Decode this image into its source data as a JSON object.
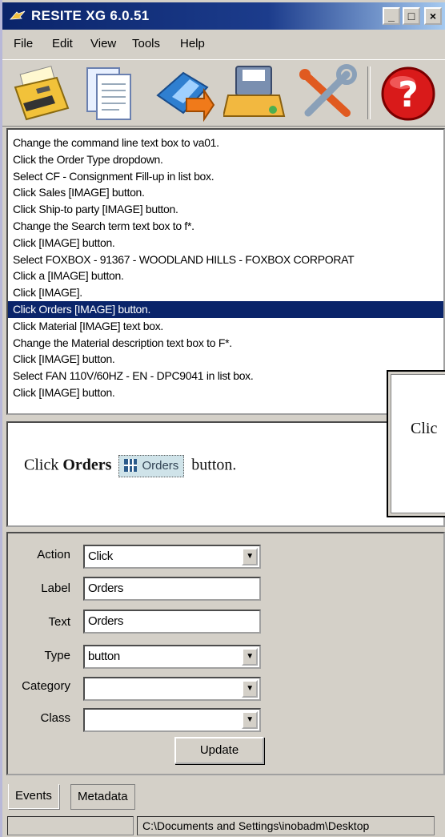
{
  "window": {
    "title": "RESITE XG 6.0.51",
    "min_label": "_",
    "max_label": "□",
    "close_label": "×"
  },
  "menu": [
    {
      "label": "File"
    },
    {
      "label": "Edit"
    },
    {
      "label": "View"
    },
    {
      "label": "Tools"
    },
    {
      "label": "Help"
    }
  ],
  "toolbar": {
    "icons": [
      "open-folder-icon",
      "copy-documents-icon",
      "import-arrow-icon",
      "save-disk-icon",
      "tools-icon",
      "help-icon"
    ],
    "help_glyph": "?"
  },
  "steps": [
    "Change the command line text box to va01.",
    "Click the Order Type dropdown.",
    "Select CF - Consignment Fill-up in list box.",
    "Click Sales [IMAGE] button.",
    "Click Ship-to party [IMAGE] button.",
    "Change the Search term text box to f*.",
    "Click  [IMAGE] button.",
    "Select FOXBOX - 91367 - WOODLAND HILLS - FOXBOX CORPORAT",
    "Click a [IMAGE] button.",
    "Click [IMAGE].",
    "Click Orders [IMAGE] button.",
    "Click Material [IMAGE] text box.",
    "Change the Material description text box to F*.",
    "Click  [IMAGE] button.",
    "Select FAN 110V/60HZ - EN - DPC9041 in list box.",
    "Click  [IMAGE] button."
  ],
  "selected_step_index": 10,
  "preview": {
    "prefix": "Click",
    "bold": "Orders",
    "image_label": "Orders",
    "suffix": "button."
  },
  "popup": {
    "text": "Clic"
  },
  "properties": {
    "action_label": "Action",
    "action_value": "Click",
    "label_label": "Label",
    "label_value": "Orders",
    "text_label": "Text",
    "text_value": "Orders",
    "type_label": "Type",
    "type_value": "button",
    "category_label": "Category",
    "category_value": "",
    "class_label": "Class",
    "class_value": "",
    "update_label": "Update"
  },
  "tabs": {
    "events": "Events",
    "metadata": "Metadata"
  },
  "status": {
    "left": "",
    "path": "C:\\Documents and Settings\\inobadm\\Desktop"
  },
  "colors": {
    "selection": "#0a246a",
    "title_start": "#0a246a",
    "title_end": "#a6caf0"
  }
}
